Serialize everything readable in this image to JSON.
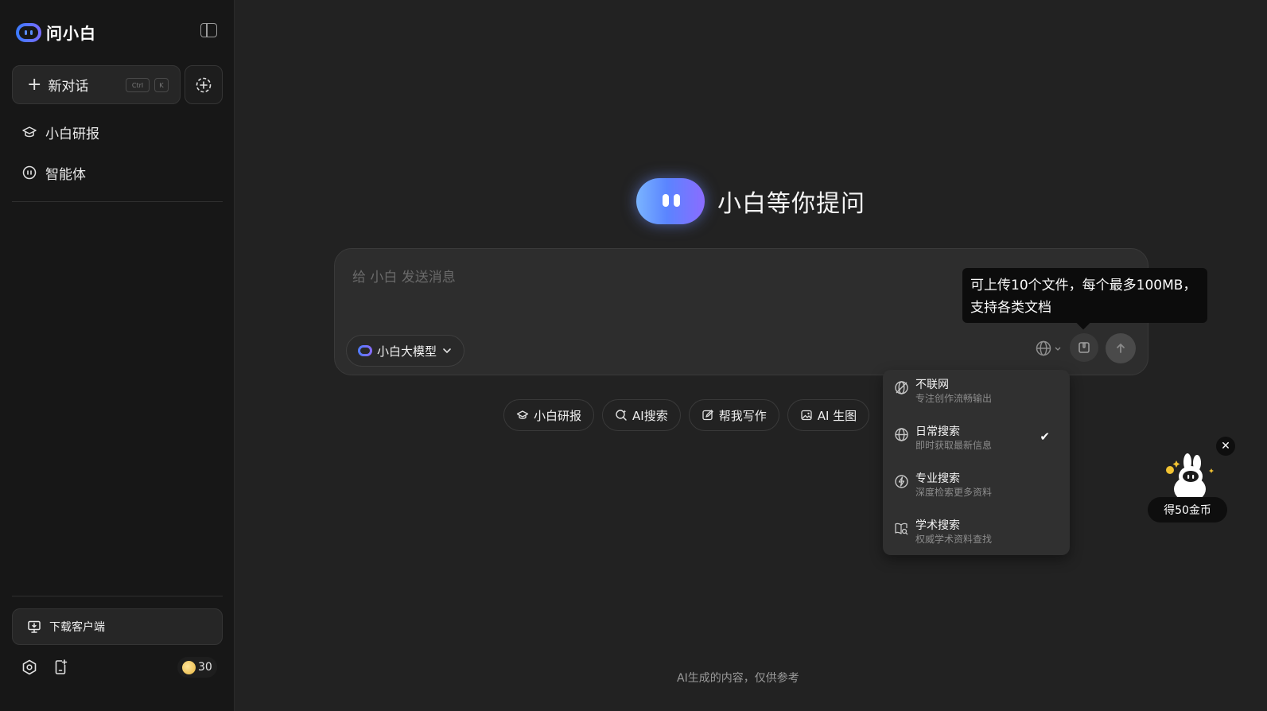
{
  "app": {
    "name": "问小白"
  },
  "sidebar": {
    "new_chat_label": "新对话",
    "shortcut_ctrl": "Ctrl",
    "shortcut_key": "K",
    "items": [
      {
        "label": "小白研报",
        "icon": "graduation-cap-icon"
      },
      {
        "label": "智能体",
        "icon": "robot-face-icon"
      }
    ],
    "download_label": "下载客户端",
    "coins": "30"
  },
  "main": {
    "hero_title": "小白等你提问",
    "composer": {
      "placeholder": "给 小白 发送消息",
      "model_label": "小白大模型"
    },
    "tooltip_line1": "可上传10个文件，每个最多100MB，",
    "tooltip_line2": "支持各类文档",
    "chips": [
      {
        "label": "小白研报",
        "icon": "graduation-cap-icon"
      },
      {
        "label": "AI搜索",
        "icon": "search-sparkle-icon"
      },
      {
        "label": "帮我写作",
        "icon": "edit-icon"
      },
      {
        "label": "AI 生图",
        "icon": "image-icon"
      }
    ],
    "search_menu": [
      {
        "title": "不联网",
        "desc": "专注创作流畅输出",
        "icon": "globe-off-icon",
        "selected": false
      },
      {
        "title": "日常搜索",
        "desc": "即时获取最新信息",
        "icon": "globe-icon",
        "selected": true
      },
      {
        "title": "专业搜索",
        "desc": "深度检索更多资料",
        "icon": "bolt-circle-icon",
        "selected": false
      },
      {
        "title": "学术搜索",
        "desc": "权威学术资料查找",
        "icon": "book-search-icon",
        "selected": false
      }
    ],
    "footer_note": "AI生成的内容，仅供参考",
    "reward_label": "得50金币"
  },
  "colors": {
    "accent": "#5a84ff",
    "background": "#222222",
    "sidebar": "#171717"
  }
}
